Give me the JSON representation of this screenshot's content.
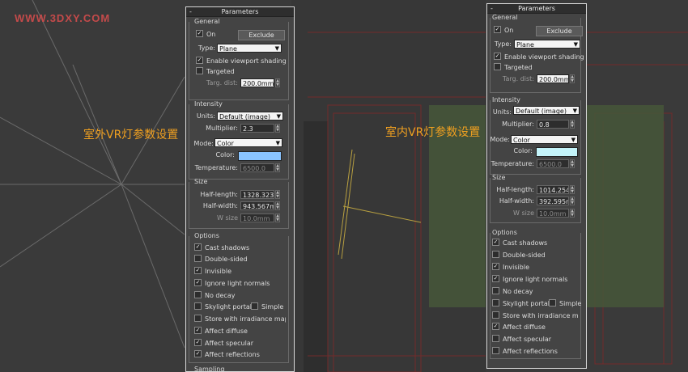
{
  "watermark": "WWW.3DXY.COM",
  "captions": {
    "left": "室外VR灯参数设置",
    "right": "室内VR灯参数设置"
  },
  "panel_common": {
    "title": "Parameters",
    "collapse": "-",
    "general": "General",
    "on": "On",
    "exclude": "Exclude",
    "type_label": "Type:",
    "type_value": "Plane",
    "viewport_shading": "Enable viewport shading",
    "targeted": "Targeted",
    "targ_dist_label": "Targ. dist:",
    "targ_dist": "200.0mm",
    "intensity": "Intensity",
    "units_label": "Units:",
    "units_value": "Default (image)",
    "multiplier_label": "Multiplier:",
    "mode_label": "Mode:",
    "mode_value": "Color",
    "color_label": "Color:",
    "temperature_label": "Temperature:",
    "temperature": "6500.0",
    "size": "Size",
    "half_length_label": "Half-length:",
    "half_width_label": "Half-width:",
    "w_size_label": "W size",
    "w_size": "10.0mm",
    "options": "Options",
    "cast_shadows": "Cast shadows",
    "double_sided": "Double-sided",
    "invisible": "Invisible",
    "ignore_light_normals": "Ignore light normals",
    "no_decay": "No decay",
    "skylight_portal": "Skylight portal",
    "simple": "Simple",
    "store_irradiance": "Store with irradiance map",
    "affect_diffuse": "Affect diffuse",
    "affect_specular": "Affect specular",
    "affect_reflections": "Affect reflections",
    "sampling": "Sampling"
  },
  "left_panel": {
    "multiplier": "2.3",
    "color": "#8ac4ff",
    "half_length": "1328.323",
    "half_width": "943.567m",
    "checks": {
      "on": true,
      "viewport_shading": true,
      "targeted": false,
      "cast_shadows": true,
      "double_sided": false,
      "invisible": true,
      "ignore_light_normals": true,
      "no_decay": false,
      "skylight_portal": false,
      "simple": false,
      "store_irradiance": false,
      "affect_diffuse": true,
      "affect_specular": true,
      "affect_reflections": true
    }
  },
  "right_panel": {
    "multiplier": "0.8",
    "color": "#c4f4fa",
    "half_length": "1014.254",
    "half_width": "392.595r",
    "checks": {
      "on": true,
      "viewport_shading": true,
      "targeted": false,
      "cast_shadows": true,
      "double_sided": false,
      "invisible": true,
      "ignore_light_normals": true,
      "no_decay": false,
      "skylight_portal": false,
      "simple": false,
      "store_irradiance": false,
      "affect_diffuse": true,
      "affect_specular": false,
      "affect_reflections": false
    }
  },
  "colors": {
    "viewport_bg": "#3a3a3a",
    "panel_bg": "#444444",
    "caption": "#f0a020",
    "wireframe_red": "#8a2a2a"
  }
}
